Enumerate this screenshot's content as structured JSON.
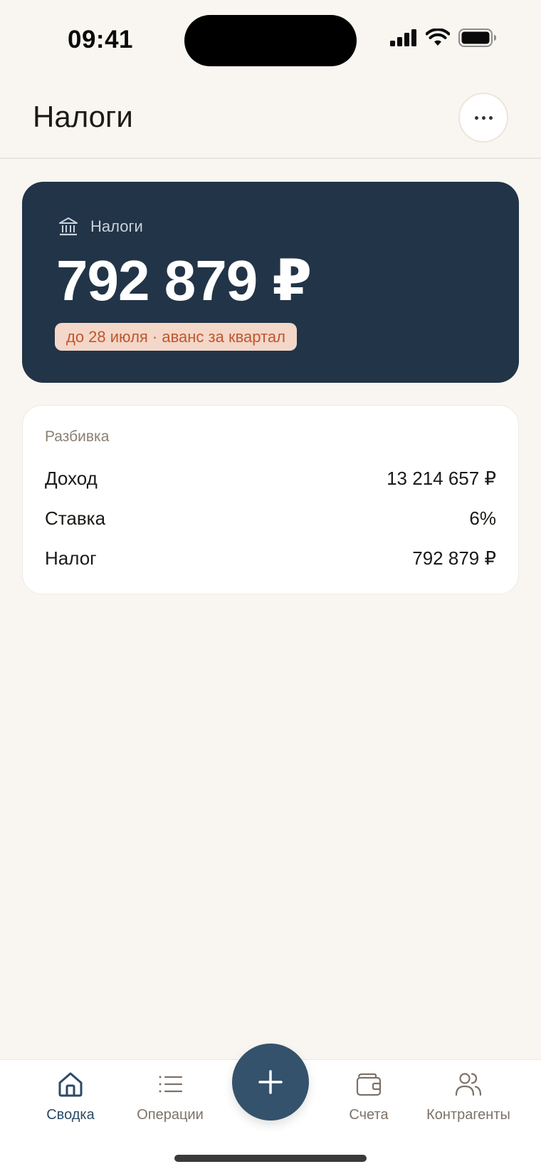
{
  "status_bar": {
    "time": "09:41"
  },
  "header": {
    "title": "Налоги"
  },
  "hero": {
    "label": "Налоги",
    "amount": "792 879 ₽",
    "badge": "до 28 июля · аванс за квартал"
  },
  "breakdown": {
    "title": "Разбивка",
    "rows": [
      {
        "label": "Доход",
        "value": "13 214 657 ₽"
      },
      {
        "label": "Ставка",
        "value": "6%"
      },
      {
        "label": "Налог",
        "value": "792 879 ₽"
      }
    ]
  },
  "tab_bar": {
    "items": [
      {
        "label": "Сводка",
        "icon": "home-icon",
        "active": true
      },
      {
        "label": "Операции",
        "icon": "list-icon",
        "active": false
      },
      {
        "label": "Счета",
        "icon": "wallet-icon",
        "active": false
      },
      {
        "label": "Контрагенты",
        "icon": "users-icon",
        "active": false
      }
    ],
    "fab_icon": "plus-icon"
  },
  "colors": {
    "background": "#f9f6f1",
    "hero_card": "#223447",
    "badge_bg": "#f3d7c9",
    "badge_text": "#c0562e",
    "accent": "#34526c",
    "active_tab": "#2c4a66"
  }
}
